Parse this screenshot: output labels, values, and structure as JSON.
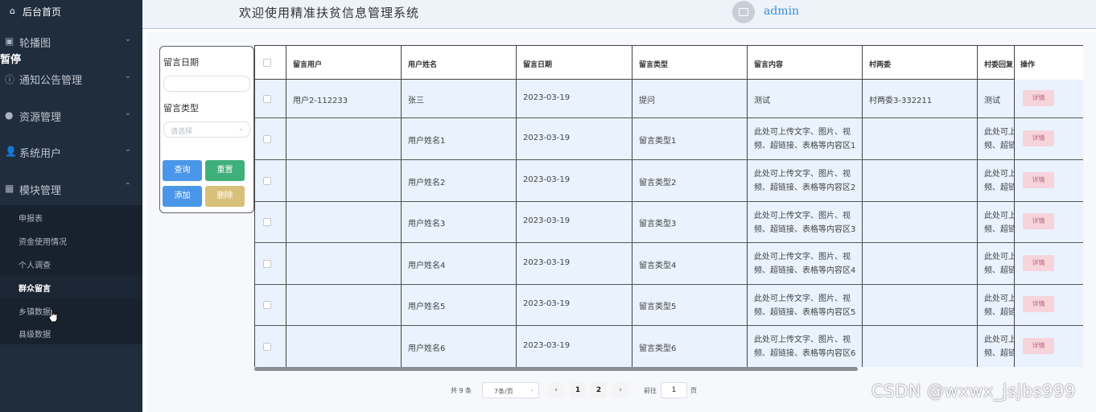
{
  "sidebar": {
    "home": "后台首页",
    "menus": [
      {
        "label": "轮播图",
        "icon": "image-icon"
      },
      {
        "label": "通知公告管理",
        "icon": "info-icon"
      },
      {
        "label": "资源管理",
        "icon": "bulb-icon"
      },
      {
        "label": "系统用户",
        "icon": "user-icon"
      },
      {
        "label": "模块管理",
        "icon": "grid-icon"
      }
    ],
    "submenu": [
      "申报表",
      "资金使用情况",
      "个人调查",
      "群众留言",
      "乡镇数据",
      "县级数据"
    ],
    "active_submenu": "群众留言",
    "paused_label": "暂停"
  },
  "header": {
    "title": "欢迎使用精准扶贫信息管理系统",
    "username": "admin"
  },
  "search": {
    "date_label": "留言日期",
    "type_label": "留言类型",
    "type_placeholder": "请选择",
    "query_btn": "查询",
    "reset_btn": "重置",
    "add_btn": "添加",
    "delete_btn": "删除"
  },
  "table": {
    "columns": [
      "留言用户",
      "用户姓名",
      "留言日期",
      "留言类型",
      "留言内容",
      "村两委",
      "村委回复",
      "操作"
    ],
    "detail_btn": "详情",
    "rows": [
      {
        "user": "用户2-112233",
        "name": "张三",
        "date": "2023-03-19",
        "type": "提问",
        "content1": "测试",
        "content2": "",
        "cwu": "村两委3-332211",
        "reply1": "测试",
        "reply2": ""
      },
      {
        "user": "",
        "name": "用户姓名1",
        "date": "2023-03-19",
        "type": "留言类型1",
        "content1": "此处可上传文字、图片、视",
        "content2": "频、超链接、表格等内容区1",
        "cwu": "",
        "reply1": "此处可上",
        "reply2": "频、超链"
      },
      {
        "user": "",
        "name": "用户姓名2",
        "date": "2023-03-19",
        "type": "留言类型2",
        "content1": "此处可上传文字、图片、视",
        "content2": "频、超链接、表格等内容区2",
        "cwu": "",
        "reply1": "此处可上",
        "reply2": "频、超链"
      },
      {
        "user": "",
        "name": "用户姓名3",
        "date": "2023-03-19",
        "type": "留言类型3",
        "content1": "此处可上传文字、图片、视",
        "content2": "频、超链接、表格等内容区3",
        "cwu": "",
        "reply1": "此处可上",
        "reply2": "频、超链"
      },
      {
        "user": "",
        "name": "用户姓名4",
        "date": "2023-03-19",
        "type": "留言类型4",
        "content1": "此处可上传文字、图片、视",
        "content2": "频、超链接、表格等内容区4",
        "cwu": "",
        "reply1": "此处可上",
        "reply2": "频、超链"
      },
      {
        "user": "",
        "name": "用户姓名5",
        "date": "2023-03-19",
        "type": "留言类型5",
        "content1": "此处可上传文字、图片、视",
        "content2": "频、超链接、表格等内容区5",
        "cwu": "",
        "reply1": "此处可上",
        "reply2": "频、超链"
      },
      {
        "user": "",
        "name": "用户姓名6",
        "date": "2023-03-19",
        "type": "留言类型6",
        "content1": "此处可上传文字、图片、视",
        "content2": "频、超链接、表格等内容区6",
        "cwu": "",
        "reply1": "此处可上",
        "reply2": "频、超链"
      }
    ]
  },
  "pagination": {
    "total": "共 9 条",
    "page_size": "7条/页",
    "prev": "‹",
    "pages": [
      "1",
      "2"
    ],
    "next": "›",
    "goto_label": "前往",
    "goto_value": "1",
    "page_unit": "页"
  },
  "watermark": "CSDN @wxwx_jsjbs999"
}
